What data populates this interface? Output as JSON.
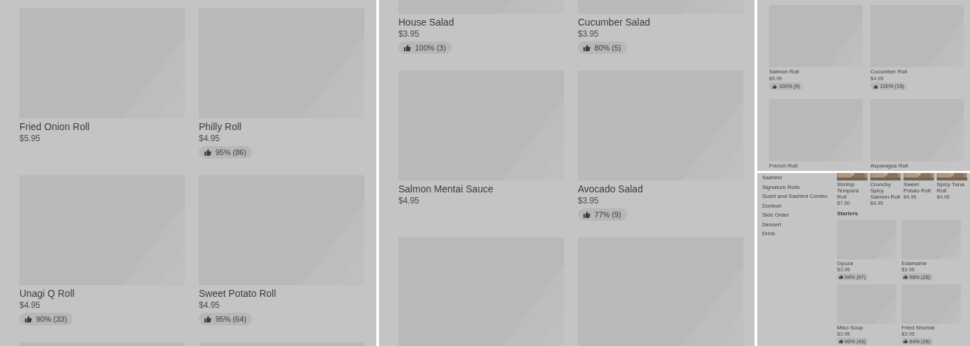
{
  "panels": [
    {
      "kind": "grid",
      "cards": [
        {
          "kind": "item",
          "name": "Fried Onion Roll",
          "price": "$5.95"
        },
        {
          "kind": "item",
          "name": "Philly Roll",
          "price": "$4.95",
          "rating": "95% (86)"
        },
        {
          "kind": "item",
          "name": "Unagi Q Roll",
          "price": "$4.95",
          "rating": "90% (33)"
        },
        {
          "kind": "item",
          "name": "Sweet Potato Roll",
          "price": "$4.95",
          "rating": "95% (64)"
        },
        {
          "kind": "image_only"
        },
        {
          "kind": "image_only"
        }
      ]
    },
    {
      "kind": "grid",
      "cards": [
        {
          "kind": "item",
          "name": "House Salad",
          "price": "$3.95",
          "rating": "100% (3)"
        },
        {
          "kind": "item",
          "name": "Cucumber Salad",
          "price": "$3.95",
          "rating": "80% (5)"
        },
        {
          "kind": "item",
          "name": "Salmon Mentai Sauce",
          "price": "$4.95"
        },
        {
          "kind": "item",
          "name": "Avocado Salad",
          "price": "$3.95",
          "rating": "77% (9)"
        },
        {
          "kind": "image_only"
        },
        {
          "kind": "image_only"
        }
      ]
    },
    {
      "kind": "grid",
      "cards": [
        {
          "kind": "item",
          "name": "Salmon Roll",
          "price": "$5.95",
          "rating": "100% (9)"
        },
        {
          "kind": "item",
          "name": "Cucumber Roll",
          "price": "$4.95",
          "rating": "100% (15)"
        },
        {
          "kind": "item",
          "name": "French Roll"
        },
        {
          "kind": "item",
          "name": "Asparagus Roll"
        }
      ]
    },
    {
      "kind": "category_menu",
      "sidebar": {
        "items": [
          "Sashimi",
          "Signature Rolls",
          "Sushi and Sashimi Combo",
          "Donburi",
          "Side Order",
          "Dessert",
          "Drink"
        ]
      },
      "top_row": [
        {
          "name": "Shrimp Tempura Roll",
          "price": "$7.50"
        },
        {
          "name": "Crunchy Spicy Salmon Roll",
          "price": "$4.95"
        },
        {
          "name": "Sweet Potato Roll",
          "price": "$4.95"
        },
        {
          "name": "Spicy Tuna Roll",
          "price": "$4.95"
        }
      ],
      "section": {
        "title": "Starters",
        "cards": [
          {
            "kind": "item",
            "name": "Gyoza",
            "price": "$3.95",
            "rating": "94% (97)"
          },
          {
            "kind": "item",
            "name": "Edamame",
            "price": "$3.95",
            "rating": "98% (28)"
          },
          {
            "kind": "item",
            "name": "Miso Soup",
            "price": "$3.95",
            "rating": "90% (43)"
          },
          {
            "kind": "item",
            "name": "Fried Shumai",
            "price": "$3.95",
            "rating": "94% (28)"
          }
        ]
      }
    }
  ]
}
